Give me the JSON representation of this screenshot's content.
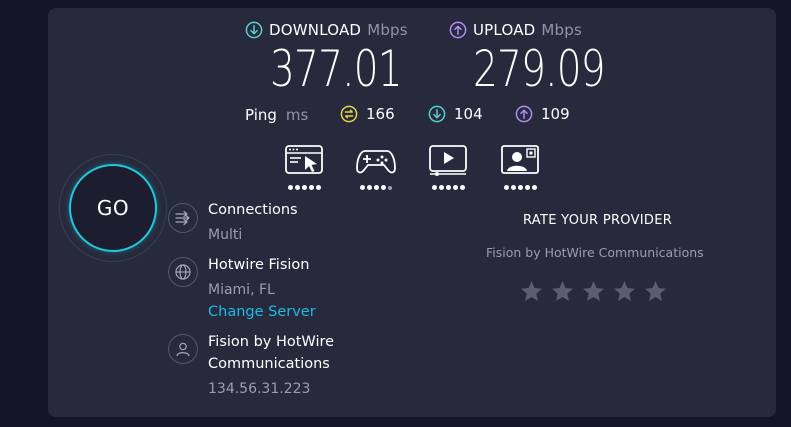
{
  "download": {
    "label": "DOWNLOAD",
    "unit": "Mbps",
    "value": "377.01",
    "icon": "download-arrow-icon",
    "color": "#57d0c9"
  },
  "upload": {
    "label": "UPLOAD",
    "unit": "Mbps",
    "value": "279.09",
    "icon": "upload-arrow-icon",
    "color": "#b08cf0"
  },
  "ping": {
    "label": "Ping",
    "unit": "ms",
    "idle": {
      "value": "166",
      "icon": "ping-idle-icon",
      "color": "#e6d442"
    },
    "download": {
      "value": "104",
      "icon": "download-arrow-icon",
      "color": "#57d0c9"
    },
    "upload": {
      "value": "109",
      "icon": "upload-arrow-icon",
      "color": "#b08cf0"
    }
  },
  "quality_ratings": [
    {
      "name": "web-browsing-icon",
      "rating": 5,
      "max": 5
    },
    {
      "name": "gaming-icon",
      "rating": 4,
      "max": 5
    },
    {
      "name": "video-streaming-icon",
      "rating": 5,
      "max": 5
    },
    {
      "name": "video-chat-icon",
      "rating": 5,
      "max": 5
    }
  ],
  "go_button": {
    "label": "GO"
  },
  "connections": {
    "title": "Connections",
    "value": "Multi",
    "icon": "connections-arrows-icon"
  },
  "server": {
    "title": "Hotwire Fision",
    "location": "Miami, FL",
    "change_link": "Change Server",
    "icon": "globe-icon"
  },
  "provider": {
    "title_line1": "Fision by HotWire",
    "title_line2": "Communications",
    "ip": "134.56.31.223",
    "icon": "user-icon"
  },
  "rate": {
    "title": "RATE YOUR PROVIDER",
    "provider_name": "Fision by HotWire Communications",
    "stars": 5,
    "star_color": "#5b5e73"
  }
}
